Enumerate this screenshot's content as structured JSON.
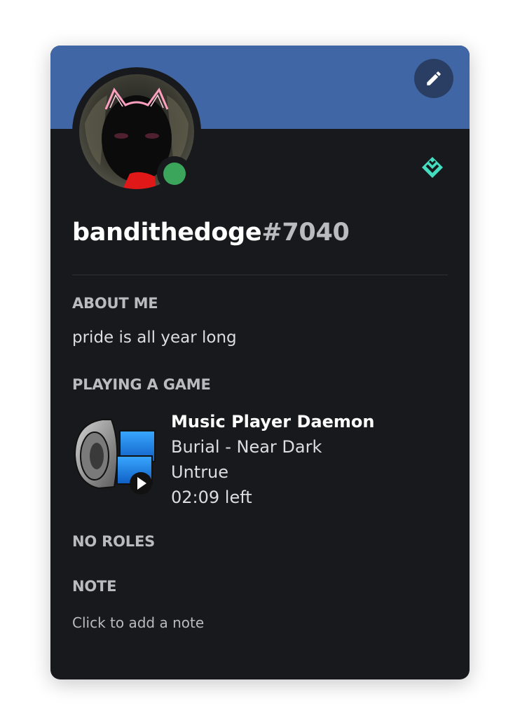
{
  "profile": {
    "username": "bandithedoge",
    "discriminator": "#7040",
    "status": "online",
    "badge_icon": "hypesquad-balance-badge",
    "banner_color": "#4166a5",
    "status_color": "#3ba55c"
  },
  "header": {
    "edit_icon": "pencil-icon"
  },
  "about": {
    "title": "ABOUT ME",
    "text": "pride is all year long"
  },
  "activity": {
    "title": "PLAYING A GAME",
    "name": "Music Player Daemon",
    "details": "Burial - Near Dark",
    "state": "Untrue",
    "time_left": "02:09 left",
    "icon": "speaker-monitor-play-icon"
  },
  "roles": {
    "title": "NO ROLES"
  },
  "note": {
    "title": "NOTE",
    "placeholder": "Click to add a note"
  }
}
